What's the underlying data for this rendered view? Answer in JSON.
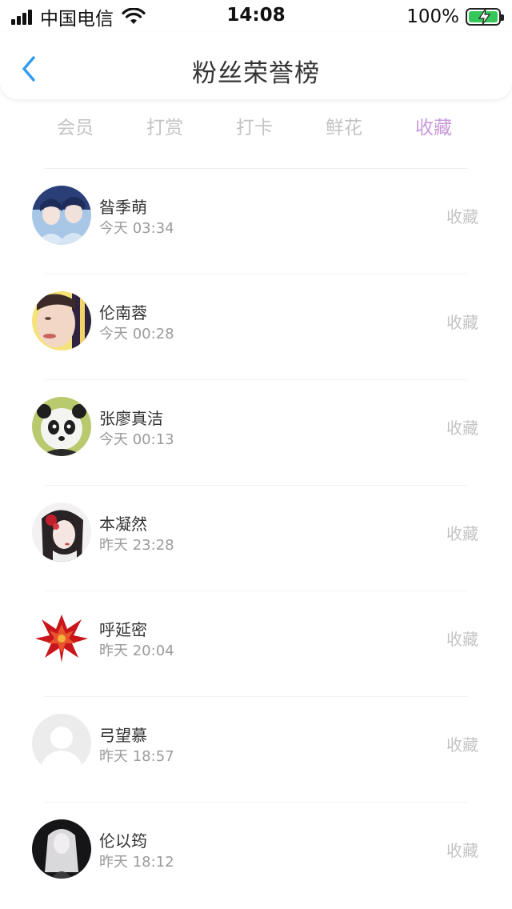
{
  "status_bar": {
    "carrier": "中国电信",
    "time": "14:08",
    "battery": "100%"
  },
  "nav": {
    "title": "粉丝荣誉榜",
    "back_icon": "chevron-left-icon"
  },
  "tabs": [
    {
      "label": "会员",
      "active": false
    },
    {
      "label": "打赏",
      "active": false
    },
    {
      "label": "打卡",
      "active": false
    },
    {
      "label": "鲜花",
      "active": false
    },
    {
      "label": "收藏",
      "active": true
    }
  ],
  "colors": {
    "accent": "#c99ad9",
    "back_arrow": "#2e9cf0",
    "muted": "#c4c4c4"
  },
  "list": [
    {
      "name": "昝季萌",
      "time": "今天 03:34",
      "action": "收藏"
    },
    {
      "name": "伦南蓉",
      "time": "今天 00:28",
      "action": "收藏"
    },
    {
      "name": "张廖真洁",
      "time": "今天 00:13",
      "action": "收藏"
    },
    {
      "name": "本凝然",
      "time": "昨天 23:28",
      "action": "收藏"
    },
    {
      "name": "呼延密",
      "time": "昨天 20:04",
      "action": "收藏"
    },
    {
      "name": "弓望慕",
      "time": "昨天 18:57",
      "action": "收藏"
    },
    {
      "name": "伦以筠",
      "time": "昨天 18:12",
      "action": "收藏"
    }
  ]
}
